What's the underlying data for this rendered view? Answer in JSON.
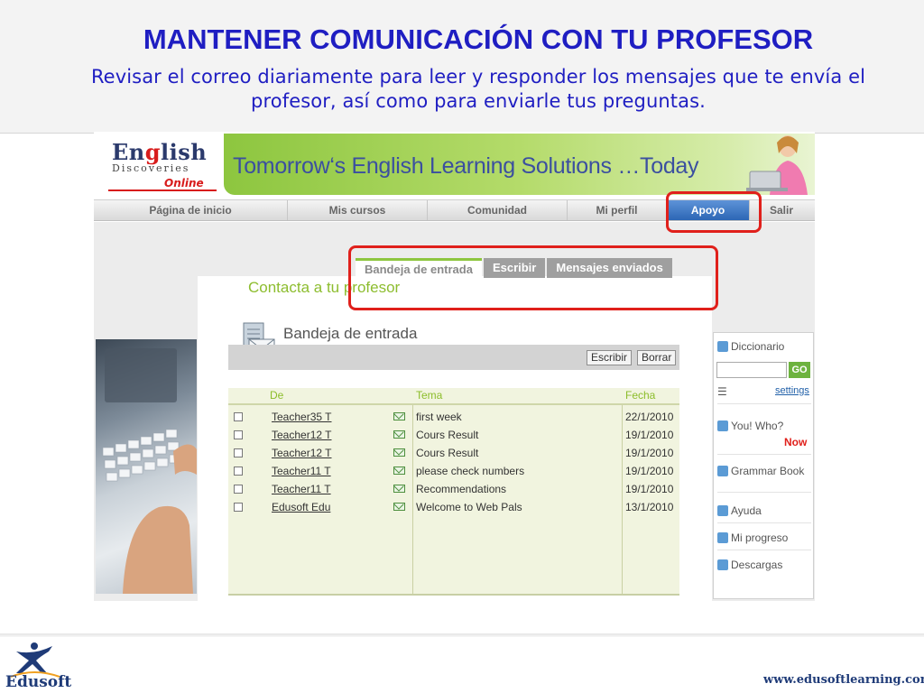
{
  "slide": {
    "title": "MANTENER COMUNICACIÓN CON TU PROFESOR",
    "subtitle_line1": "Revisar el correo diariamente para leer y responder los mensajes que te envía el",
    "subtitle_line2": "profesor, así como para enviarle tus preguntas."
  },
  "site": {
    "logo_line1_a": "En",
    "logo_line1_b": "g",
    "logo_line1_c": "lish",
    "logo_line2": "Discoveries",
    "logo_line3": "Online",
    "tagline": "Tomorrow‘s English Learning Solutions …Today"
  },
  "nav": {
    "items": [
      {
        "label": "Página de inicio",
        "active": false
      },
      {
        "label": "Mis cursos",
        "active": false
      },
      {
        "label": "Comunidad",
        "active": false
      },
      {
        "label": "Mi perfil",
        "active": false
      },
      {
        "label": "Apoyo",
        "active": true
      },
      {
        "label": "Salir",
        "active": false
      }
    ]
  },
  "tabs": [
    {
      "label": "Bandeja de entrada",
      "active": true
    },
    {
      "label": "Escribir",
      "active": false
    },
    {
      "label": "Mensajes enviados",
      "active": false
    }
  ],
  "contact_heading": "Contacta a tu profesor",
  "inbox": {
    "title": "Bandeja de entrada",
    "write_button": "Escribir",
    "delete_button": "Borrar",
    "columns": [
      "De",
      "Tema",
      "Fecha"
    ],
    "rows": [
      {
        "from": "Teacher35 T",
        "subject": "first week",
        "date": "22/1/2010"
      },
      {
        "from": "Teacher12 T",
        "subject": "Cours Result",
        "date": "19/1/2010"
      },
      {
        "from": "Teacher12 T",
        "subject": "Cours Result",
        "date": "19/1/2010"
      },
      {
        "from": "Teacher11 T",
        "subject": "please check numbers",
        "date": "19/1/2010"
      },
      {
        "from": "Teacher11 T",
        "subject": "Recommendations",
        "date": "19/1/2010"
      },
      {
        "from": "Edusoft Edu",
        "subject": "Welcome to Web Pals",
        "date": "13/1/2010"
      }
    ]
  },
  "sidebar": {
    "dictionary": "Diccionario",
    "go": "GO",
    "settings": "settings",
    "you_who": "You! Who?",
    "now": "Now",
    "grammar": "Grammar Book",
    "help": "Ayuda",
    "progress": "Mi progreso",
    "downloads": "Descargas"
  },
  "footer": {
    "brand": "Edusoft",
    "website": "www.edusoftlearning.com"
  },
  "colors": {
    "title_blue": "#1f1ec2",
    "highlight_red": "#e0201b",
    "brand_green": "#8dc63f",
    "active_blue": "#2c66b5"
  }
}
